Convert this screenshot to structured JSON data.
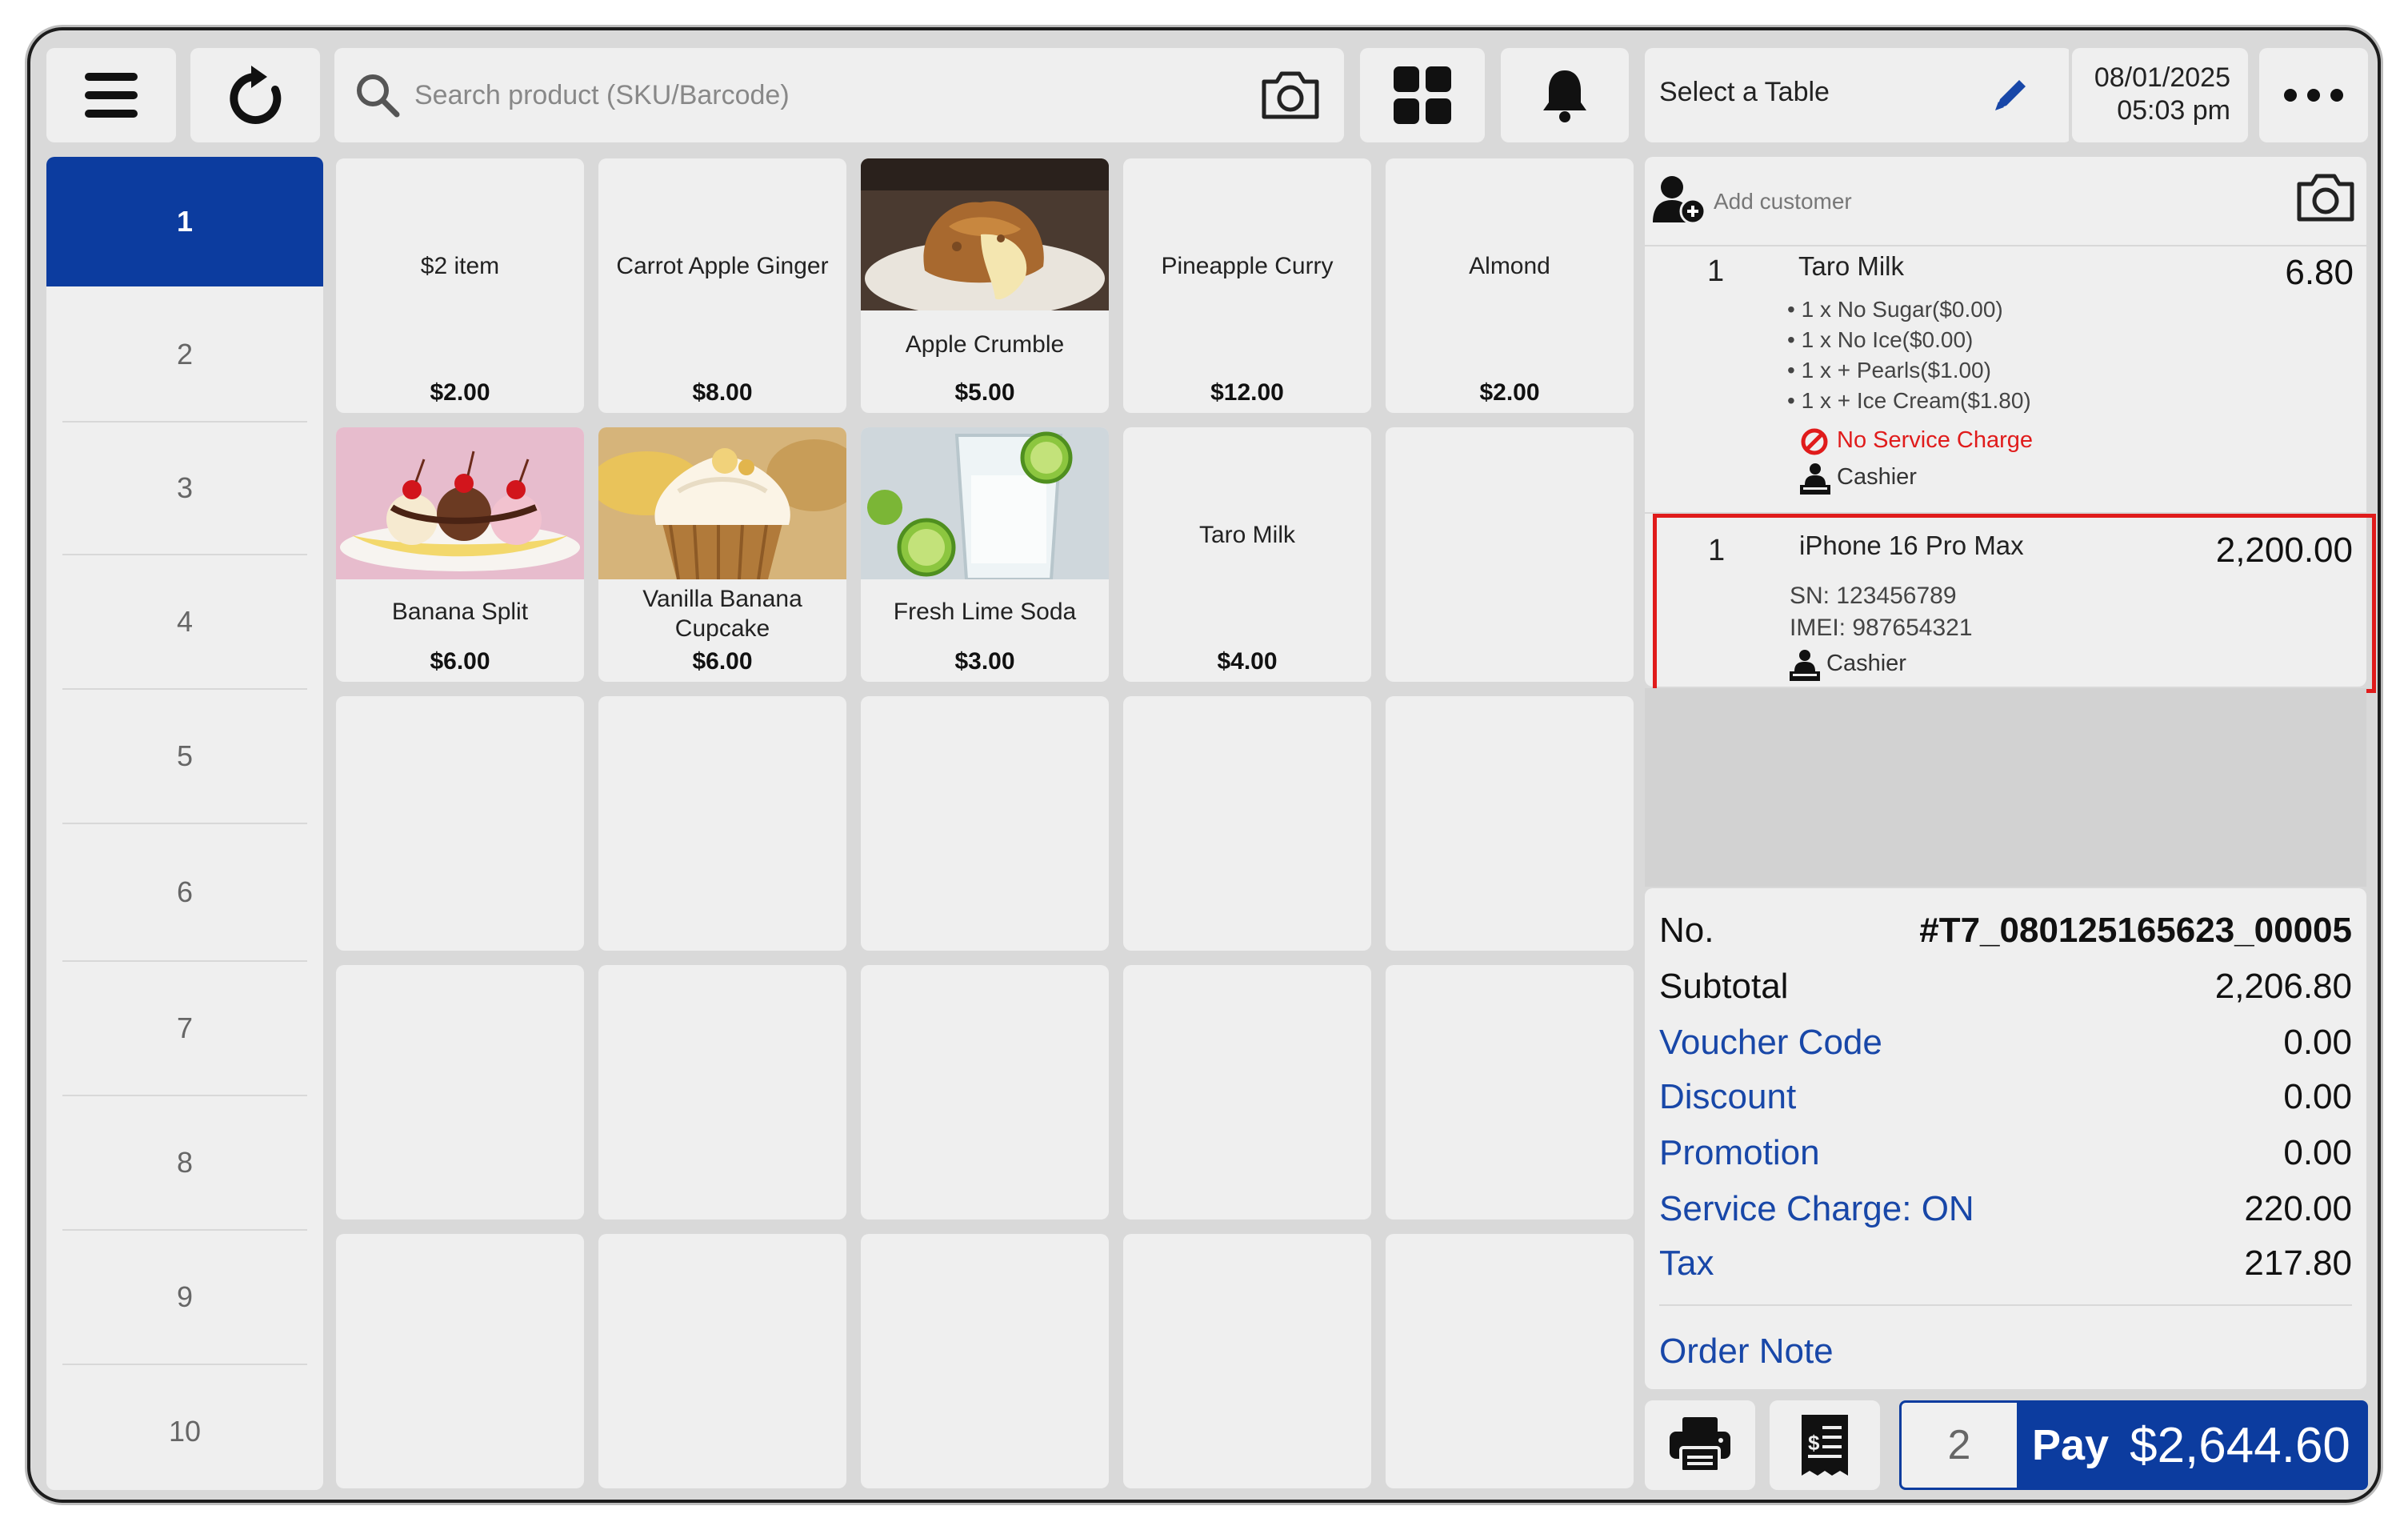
{
  "topbar": {
    "search_placeholder": "Search product (SKU/Barcode)",
    "table_label": "Select a Table",
    "date": "08/01/2025",
    "time": "05:03 pm"
  },
  "pages": [
    "1",
    "2",
    "3",
    "4",
    "5",
    "6",
    "7",
    "8",
    "9",
    "10"
  ],
  "products": [
    {
      "name": "$2 item",
      "price": "$2.00"
    },
    {
      "name": "Carrot Apple Ginger",
      "price": "$8.00"
    },
    {
      "name": "Apple Crumble",
      "price": "$5.00"
    },
    {
      "name": "Pineapple Curry",
      "price": "$12.00"
    },
    {
      "name": "Almond",
      "price": "$2.00"
    },
    {
      "name": "Banana Split",
      "price": "$6.00"
    },
    {
      "name": "Vanilla Banana Cupcake",
      "price": "$6.00"
    },
    {
      "name": "Fresh Lime Soda",
      "price": "$3.00"
    },
    {
      "name": "Taro Milk",
      "price": "$4.00"
    }
  ],
  "cart": {
    "add_customer": "Add customer",
    "items": [
      {
        "qty": "1",
        "name": "Taro Milk",
        "price": "6.80",
        "modifiers": [
          "1 x No Sugar($0.00)",
          "1 x No Ice($0.00)",
          "1 x + Pearls($1.00)",
          "1 x + Ice Cream($1.80)"
        ],
        "service_note": "No Service Charge",
        "staff": "Cashier"
      },
      {
        "qty": "1",
        "name": "iPhone 16 Pro Max",
        "price": "2,200.00",
        "sn": "SN: 123456789",
        "imei": "IMEI: 987654321",
        "staff": "Cashier"
      }
    ]
  },
  "summary": {
    "no_label": "No.",
    "no_value": "#T7_080125165623_00005",
    "subtotal_label": "Subtotal",
    "subtotal_value": "2,206.80",
    "voucher_label": "Voucher Code",
    "voucher_value": "0.00",
    "discount_label": "Discount",
    "discount_value": "0.00",
    "promotion_label": "Promotion",
    "promotion_value": "0.00",
    "service_label": "Service Charge: ON",
    "service_value": "220.00",
    "tax_label": "Tax",
    "tax_value": "217.80",
    "order_note_label": "Order Note"
  },
  "bottom": {
    "pax": "2",
    "pay_label": "Pay",
    "pay_amount": "$2,644.60"
  },
  "colors": {
    "accent": "#0c3c9f",
    "link": "#1847a8",
    "highlight_border": "#e01b1b",
    "warning": "#e01b1b"
  }
}
